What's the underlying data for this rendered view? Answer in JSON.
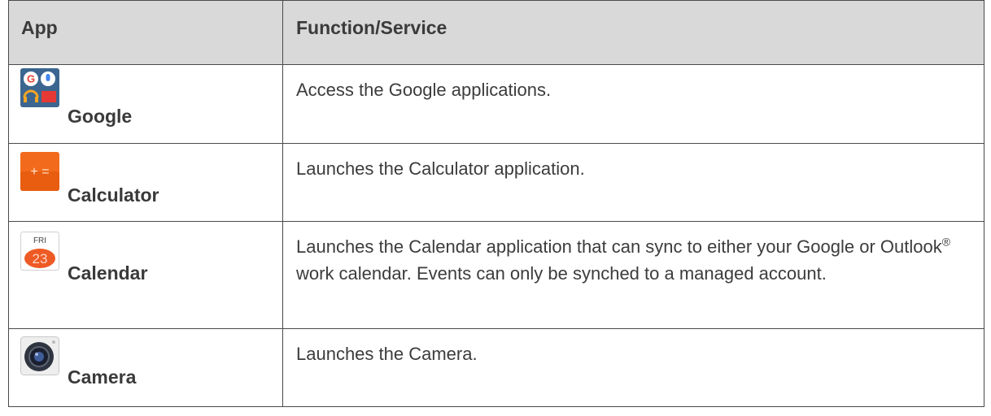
{
  "table": {
    "headers": [
      "App",
      "Function/Service"
    ],
    "rows": [
      {
        "name": "Google",
        "icon": "google-apps-folder-icon",
        "description": "Access the Google applications."
      },
      {
        "name": "Calculator",
        "icon": "calculator-icon",
        "description": "Launches the Calculator application."
      },
      {
        "name": "Calendar",
        "icon": "calendar-icon",
        "icon_day": "FRI",
        "icon_date": "23",
        "description_part1": "Launches the Calendar application that can sync to either your Google or Outlook",
        "description_reg": "®",
        "description_part2": " work calendar. Events can only be synched to a managed account."
      },
      {
        "name": "Camera",
        "icon": "camera-icon",
        "description": "Launches the Camera."
      }
    ]
  },
  "colors": {
    "header_bg": "#d9d9d9",
    "border": "#4a4a4a",
    "calculator_orange": "#f26b1d",
    "calendar_orange": "#ee5a24"
  }
}
